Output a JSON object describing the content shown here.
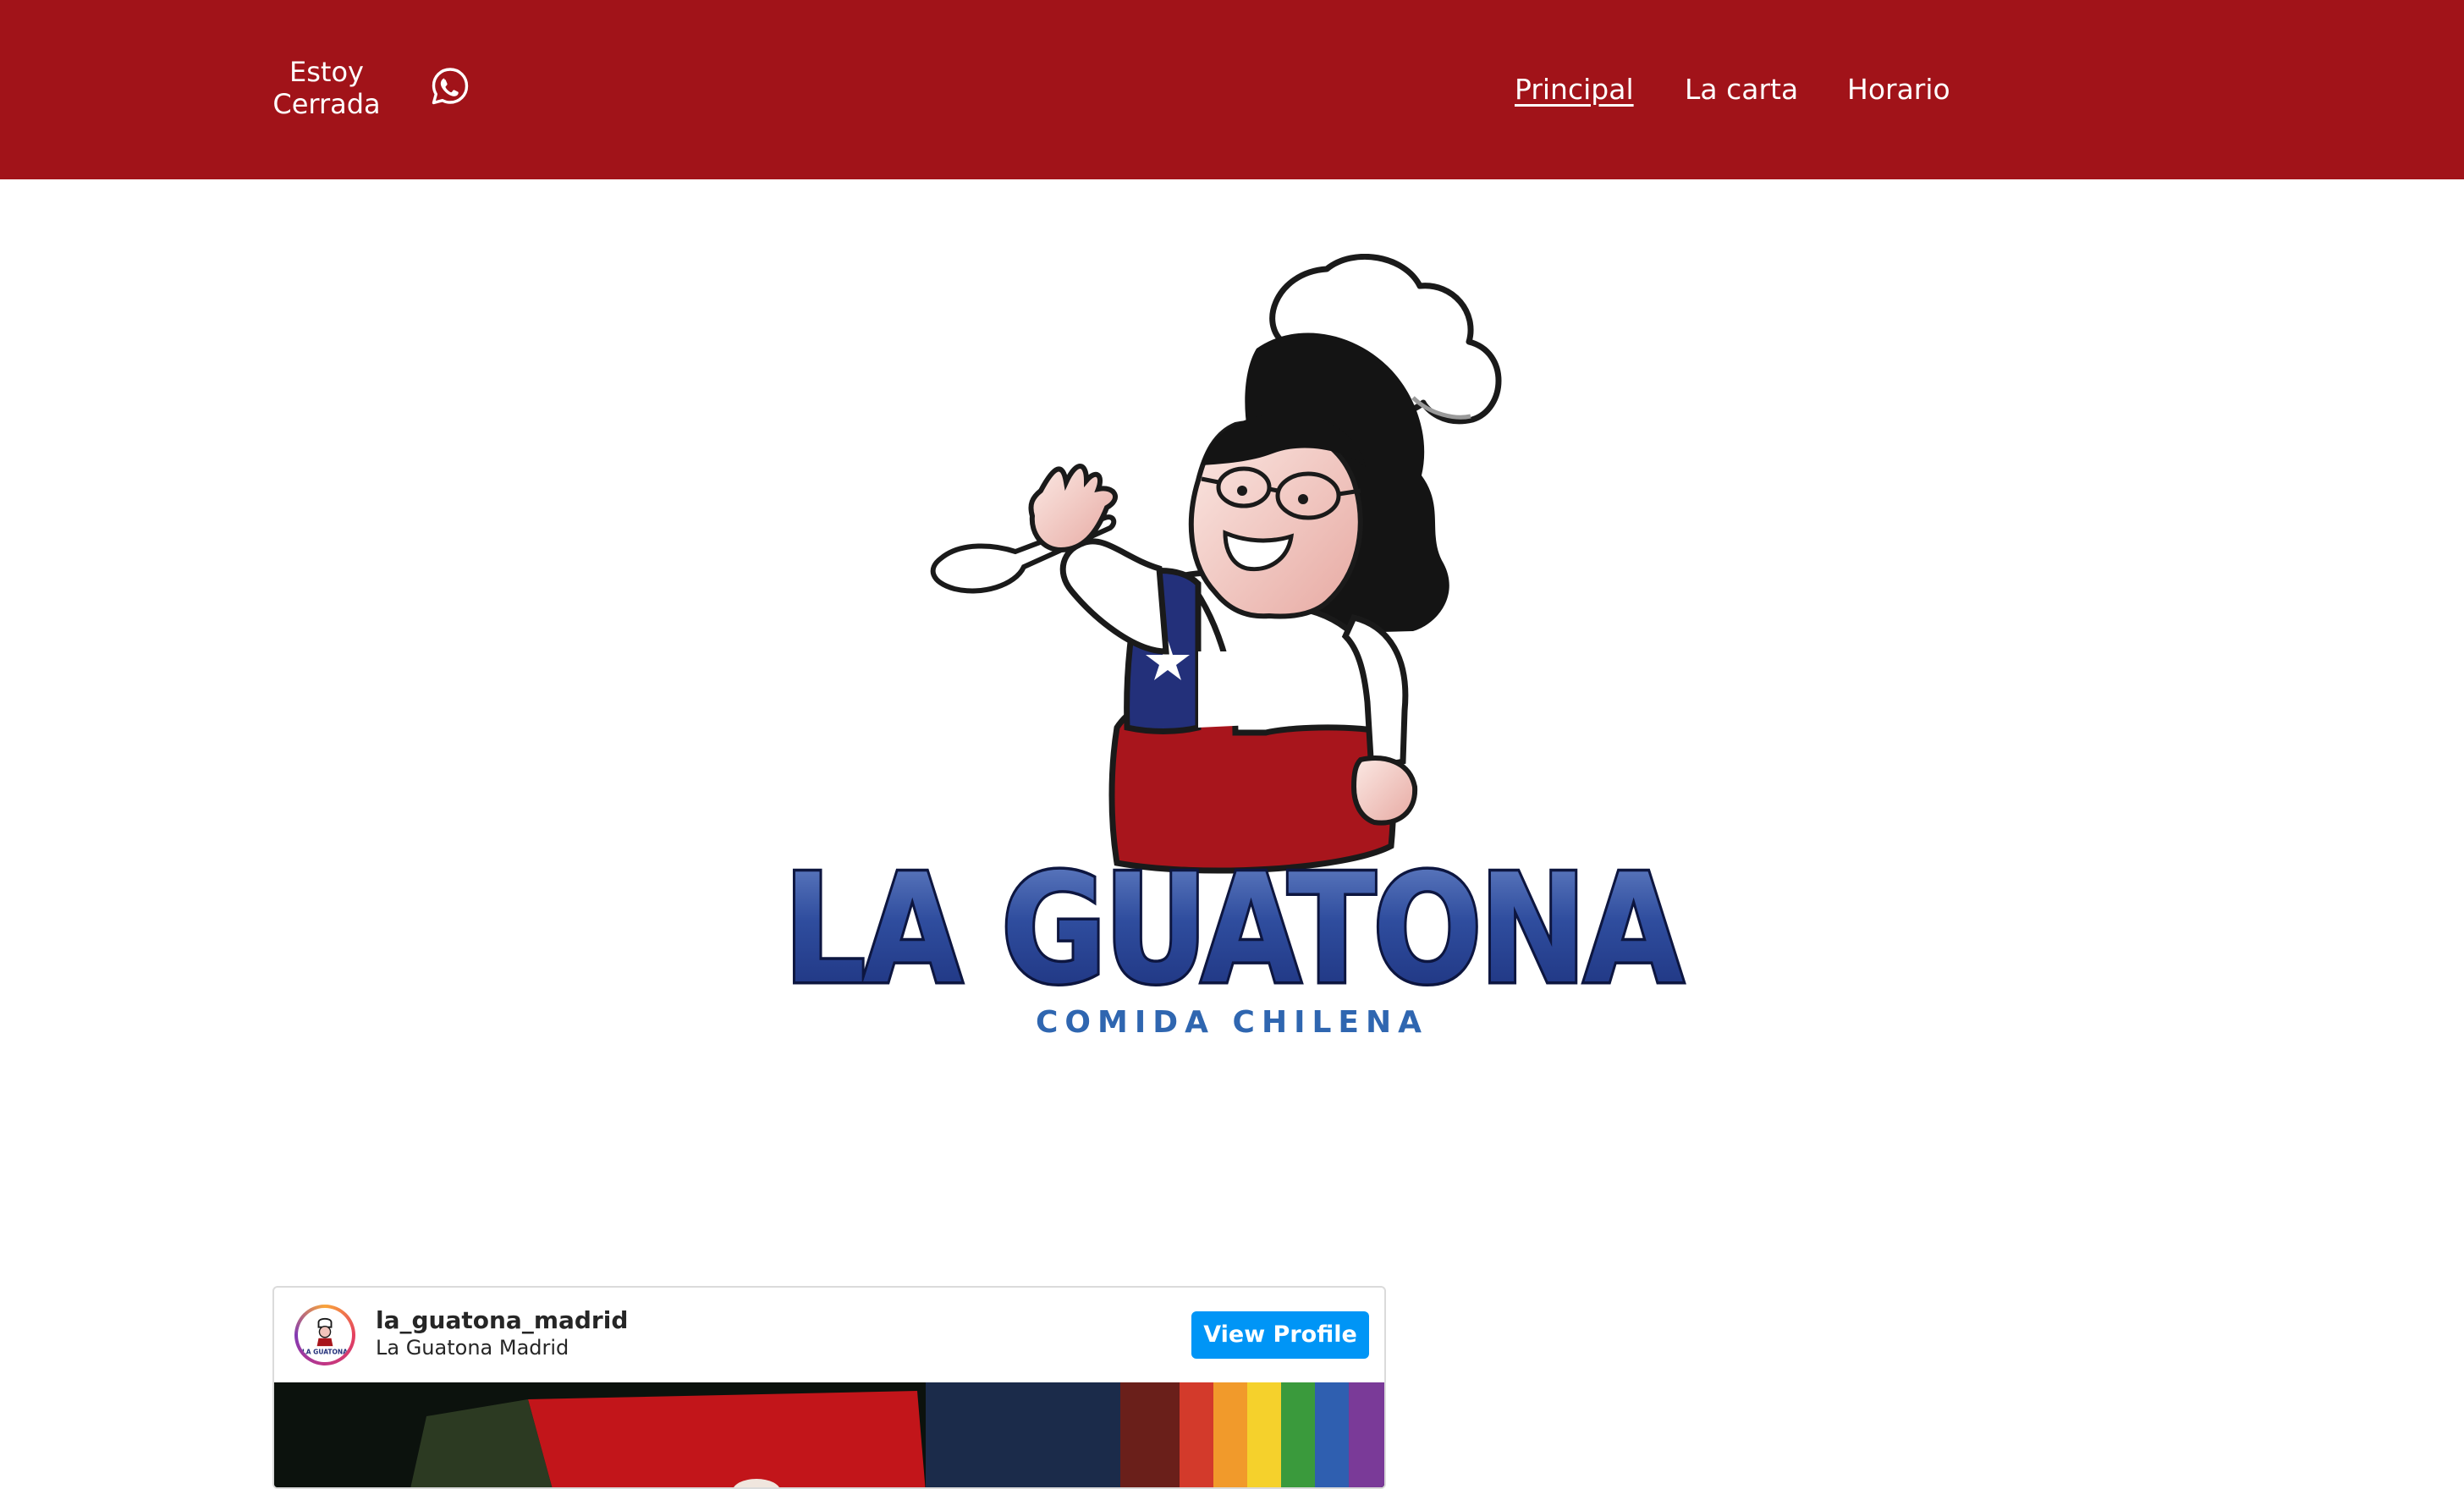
{
  "header": {
    "status_line1": "Estoy",
    "status_line2": "Cerrada",
    "whatsapp_icon": "whatsapp-icon",
    "nav": [
      "Principal",
      "La carta",
      "Horario"
    ],
    "bg_color": "#a11319"
  },
  "logo": {
    "title": "LA GUATONA",
    "subtitle": "COMIDA CHILENA"
  },
  "instagram": {
    "username": "la_guatona_madrid",
    "name": "La Guatona Madrid",
    "button": "View Profile",
    "avatar_text": "LA GUATONA",
    "button_color": "#0095f6"
  }
}
